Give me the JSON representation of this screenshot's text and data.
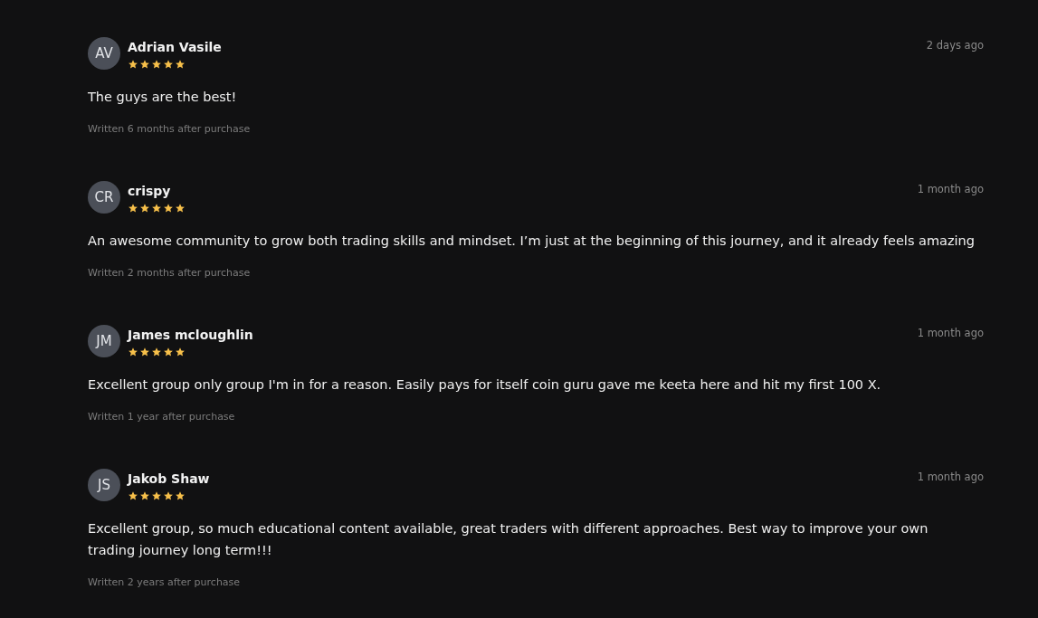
{
  "reviews": [
    {
      "initials": "AV",
      "name": "Adrian Vasile",
      "stars": 5,
      "time": "2 days ago",
      "text": "The guys are the best!",
      "footer": "Written 6 months after purchase"
    },
    {
      "initials": "CR",
      "name": "crispy",
      "stars": 5,
      "time": "1 month ago",
      "text": "An awesome community to grow both trading skills and mindset. I’m just at the beginning of this journey, and it already feels amazing",
      "footer": "Written 2 months after purchase"
    },
    {
      "initials": "JM",
      "name": "James mcloughlin",
      "stars": 5,
      "time": "1 month ago",
      "text": "Excellent group only group I'm in for a reason. Easily pays for itself coin guru gave me keeta here and hit my first 100 X.",
      "footer": "Written 1 year after purchase"
    },
    {
      "initials": "JS",
      "name": "Jakob Shaw",
      "stars": 5,
      "time": "1 month ago",
      "text": "Excellent group, so much educational content available, great traders with different approaches. Best way to improve your own trading journey long term!!!",
      "footer": "Written 2 years after purchase"
    }
  ]
}
